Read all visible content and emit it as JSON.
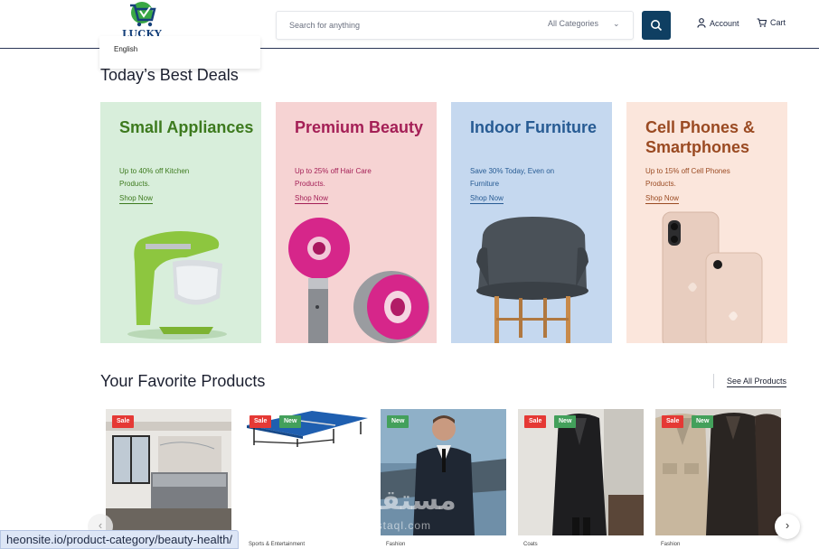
{
  "header": {
    "logo_text": "LUCKY CART",
    "language": "English",
    "search": {
      "placeholder": "Search for anything",
      "category": "All Categories"
    },
    "account_label": "Account",
    "cart_label": "Cart",
    "accent": "#0f3f62"
  },
  "deals": {
    "title": "Today’s Best Deals",
    "cards": [
      {
        "title": "Small Appliances",
        "subtitle": "Up to 40% off Kitchen Products.",
        "link": "Shop Now",
        "bg": "#d8eedb",
        "color": "#3d7a1e"
      },
      {
        "title": "Premium Beauty",
        "subtitle": "Up to 25% off Hair Care Products.",
        "link": "Shop Now",
        "bg": "#f6d3d3",
        "color": "#a41f56"
      },
      {
        "title": "Indoor Furniture",
        "subtitle": "Save 30% Today, Even on Furniture",
        "link": "Shop Now",
        "bg": "#c5d8ef",
        "color": "#275b93"
      },
      {
        "title": "Cell Phones & Smartphones",
        "subtitle": "Up to 15% off Cell Phones Products.",
        "link": "Shop Now",
        "bg": "#fbe6dc",
        "color": "#9a4a22"
      }
    ]
  },
  "favorites": {
    "title": "Your Favorite Products",
    "see_all": "See All Products",
    "products": [
      {
        "category": "",
        "badges": [
          "Sale"
        ]
      },
      {
        "category": "Sports & Entertainment",
        "badges": [
          "Sale",
          "New"
        ]
      },
      {
        "category": "Fashion",
        "badges": [
          "New"
        ]
      },
      {
        "category": "Coats",
        "badges": [
          "Sale",
          "New"
        ]
      },
      {
        "category": "Fashion",
        "badges": [
          "Sale",
          "New"
        ]
      }
    ]
  },
  "watermark": {
    "arabic": "مستقل",
    "latin": "mostaql.com"
  },
  "status_url": "heonsite.io/product-category/beauty-health/"
}
